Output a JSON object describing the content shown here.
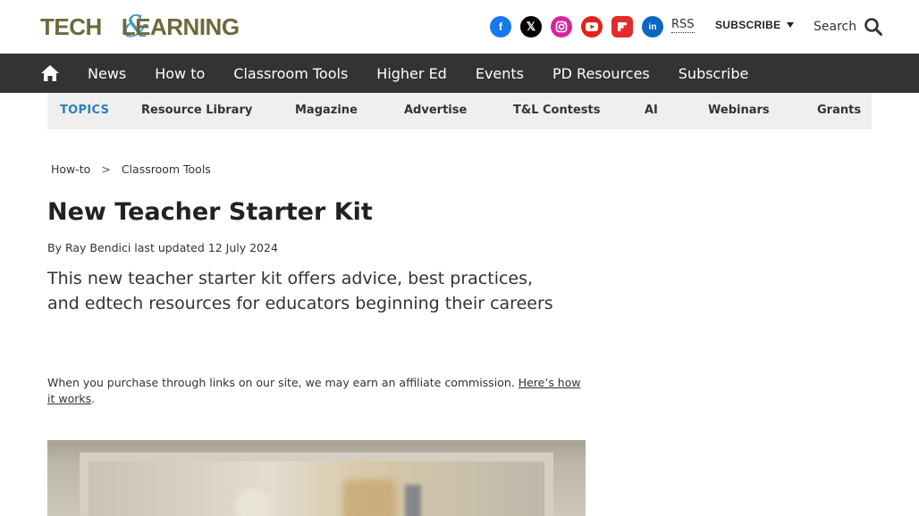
{
  "header": {
    "logo_text_a": "TECH",
    "logo_amp": "&",
    "logo_text_b": "LEARNING",
    "social_icons": [
      "facebook-icon",
      "x-icon",
      "instagram-icon",
      "youtube-icon",
      "flipboard-icon",
      "linkedin-icon"
    ],
    "rss": "RSS",
    "subscribe": "SUBSCRIBE",
    "search": "Search"
  },
  "nav": {
    "items": [
      "News",
      "How to",
      "Classroom Tools",
      "Higher Ed",
      "Events",
      "PD Resources",
      "Subscribe"
    ]
  },
  "topics": {
    "label": "TOPICS",
    "items": [
      "Resource Library",
      "Magazine",
      "Advertise",
      "T&L Contests",
      "AI",
      "Webinars",
      "Grants"
    ]
  },
  "breadcrumb": {
    "items": [
      "How-to",
      "Classroom Tools"
    ],
    "separator": ">"
  },
  "article": {
    "title": "New Teacher Starter Kit",
    "byline": "By Ray Bendici last updated 12 July 2024",
    "lede": "This new teacher starter kit offers advice, best practices, and edtech resources for educators beginning their careers",
    "affiliate_text": "When you purchase through links on our site, we may earn an affiliate commission.",
    "affiliate_link": "Here’s how it works",
    "affiliate_end": "."
  },
  "colors": {
    "navbar": "#333333",
    "topics_bg": "#efefef",
    "topics_label": "#2e7fb8",
    "logo_olive": "#6b6b3a",
    "logo_blue": "#2e8fb8"
  }
}
